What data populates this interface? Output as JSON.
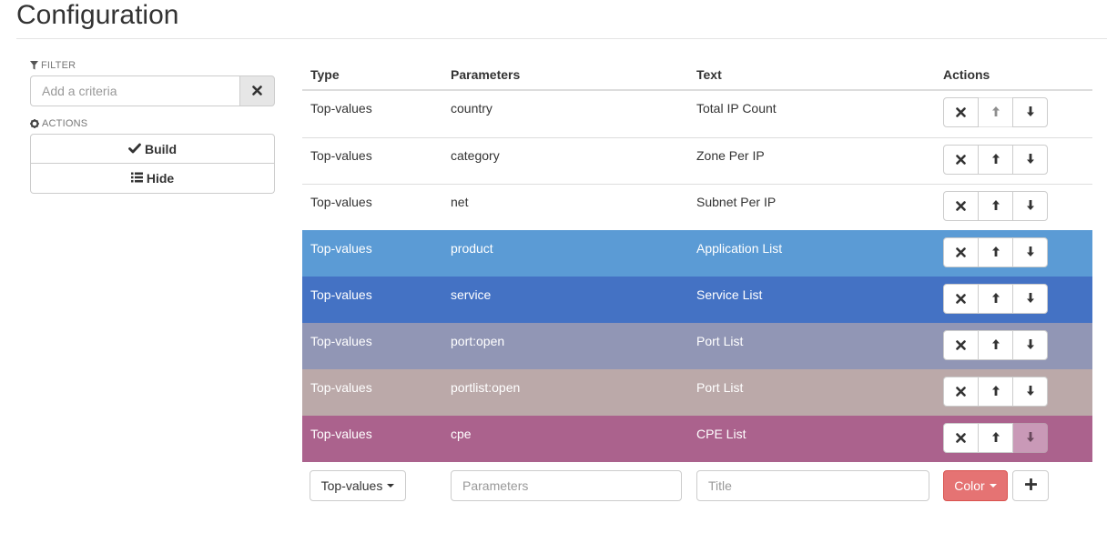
{
  "page": {
    "title": "Configuration"
  },
  "sidebar": {
    "filter_label": "FILTER",
    "filter_placeholder": "Add a criteria",
    "actions_label": "ACTIONS",
    "build_label": "Build",
    "hide_label": "Hide"
  },
  "table": {
    "headers": {
      "type": "Type",
      "parameters": "Parameters",
      "text": "Text",
      "actions": "Actions"
    },
    "rows": [
      {
        "type": "Top-values",
        "parameters": "country",
        "text": "Total IP Count",
        "color": ""
      },
      {
        "type": "Top-values",
        "parameters": "category",
        "text": "Zone Per IP",
        "color": ""
      },
      {
        "type": "Top-values",
        "parameters": "net",
        "text": "Subnet Per IP",
        "color": ""
      },
      {
        "type": "Top-values",
        "parameters": "product",
        "text": "Application List",
        "color": "#5b9bd5"
      },
      {
        "type": "Top-values",
        "parameters": "service",
        "text": "Service List",
        "color": "#4472c4"
      },
      {
        "type": "Top-values",
        "parameters": "port:open",
        "text": "Port List",
        "color": "#9196b5"
      },
      {
        "type": "Top-values",
        "parameters": "portlist:open",
        "text": "Port List",
        "color": "#bba9a9"
      },
      {
        "type": "Top-values",
        "parameters": "cpe",
        "text": "CPE List",
        "color": "#ab628d"
      }
    ]
  },
  "add_row": {
    "type_label": "Top-values",
    "parameters_placeholder": "Parameters",
    "title_placeholder": "Title",
    "color_label": "Color",
    "color_hex": "#e57373"
  },
  "icons": {
    "filter": "filter-icon",
    "clear": "close-icon",
    "actions": "gear-icon",
    "build": "check-icon",
    "hide": "list-icon",
    "remove": "close-icon",
    "up": "arrow-up-icon",
    "down": "arrow-down-icon",
    "add": "plus-icon"
  }
}
